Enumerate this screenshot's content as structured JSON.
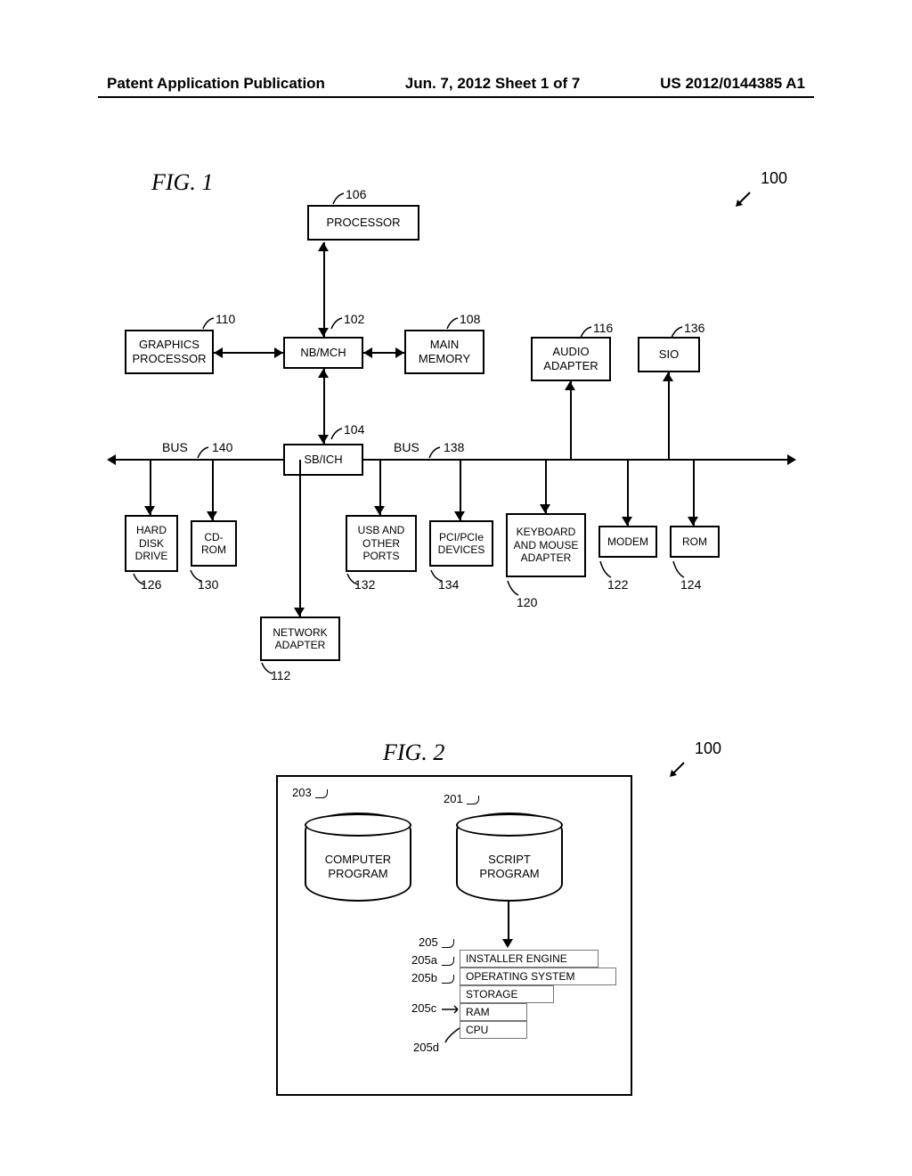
{
  "header": {
    "left": "Patent Application Publication",
    "center": "Jun. 7, 2012  Sheet 1 of 7",
    "right": "US 2012/0144385 A1"
  },
  "fig1": {
    "label": "FIG. 1",
    "ref100": "100",
    "boxes": {
      "processor": "PROCESSOR",
      "graphics": "GRAPHICS PROCESSOR",
      "nbmch": "NB/MCH",
      "mainmem": "MAIN MEMORY",
      "audio": "AUDIO ADAPTER",
      "sio": "SIO",
      "sbich": "SB/ICH",
      "hdd": "HARD DISK DRIVE",
      "cdrom": "CD-ROM",
      "usb": "USB AND OTHER PORTS",
      "pci": "PCI/PCIe DEVICES",
      "kbm": "KEYBOARD AND MOUSE ADAPTER",
      "modem": "MODEM",
      "rom": "ROM",
      "netadapter": "NETWORK ADAPTER"
    },
    "refs": {
      "r106": "106",
      "r110": "110",
      "r102": "102",
      "r108": "108",
      "r116": "116",
      "r136": "136",
      "r104": "104",
      "r140": "140",
      "r138": "138",
      "r126": "126",
      "r130": "130",
      "r132": "132",
      "r134": "134",
      "r120": "120",
      "r122": "122",
      "r124": "124",
      "r112": "112"
    },
    "buslabel": "BUS"
  },
  "fig2": {
    "label": "FIG. 2",
    "ref100": "100",
    "cylinders": {
      "program": "COMPUTER PROGRAM",
      "script": "SCRIPT PROGRAM"
    },
    "stack": {
      "installer": "INSTALLER ENGINE",
      "os": "OPERATING SYSTEM",
      "storage": "STORAGE",
      "ram": "RAM",
      "cpu": "CPU"
    },
    "refs": {
      "r201": "201",
      "r203": "203",
      "r205": "205",
      "r205a": "205a",
      "r205b": "205b",
      "r205c": "205c",
      "r205d": "205d"
    }
  }
}
